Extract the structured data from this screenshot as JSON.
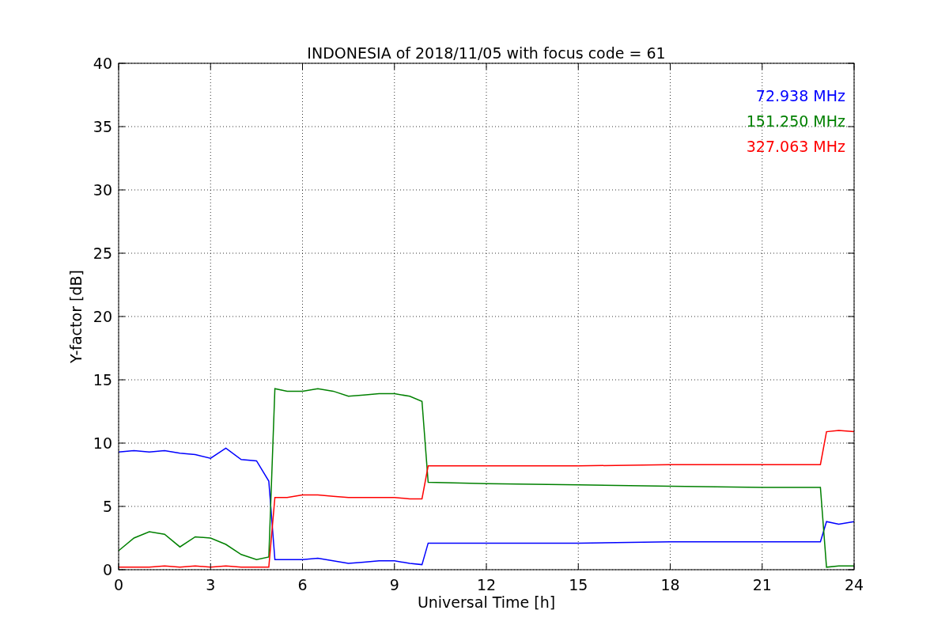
{
  "figure": {
    "chart_data": {
      "type": "line",
      "title": "INDONESIA of 2018/11/05 with focus code = 61",
      "xlabel": "Universal Time [h]",
      "ylabel": "Y-factor [dB]",
      "x": [
        0,
        0.5,
        1,
        1.5,
        2,
        2.5,
        3,
        3.5,
        4,
        4.5,
        4.9,
        5.1,
        5.5,
        6,
        6.5,
        7,
        7.5,
        8,
        8.5,
        9,
        9.5,
        9.9,
        10.1,
        12,
        15,
        18,
        21,
        22.9,
        23.1,
        23.5,
        24
      ],
      "series": [
        {
          "name": "72.938 MHz",
          "color": "#0000ff",
          "values": [
            9.3,
            9.4,
            9.3,
            9.4,
            9.2,
            9.1,
            8.8,
            9.6,
            8.7,
            8.6,
            7.0,
            0.8,
            0.8,
            0.8,
            0.9,
            0.7,
            0.5,
            0.6,
            0.7,
            0.7,
            0.5,
            0.4,
            2.1,
            2.1,
            2.1,
            2.2,
            2.2,
            2.2,
            3.8,
            3.6,
            3.8
          ]
        },
        {
          "name": "151.250 MHz",
          "color": "#008000",
          "values": [
            1.5,
            2.5,
            3.0,
            2.8,
            1.8,
            2.6,
            2.5,
            2.0,
            1.2,
            0.8,
            1.0,
            14.3,
            14.1,
            14.1,
            14.3,
            14.1,
            13.7,
            13.8,
            13.9,
            13.9,
            13.7,
            13.3,
            6.9,
            6.8,
            6.7,
            6.6,
            6.5,
            6.5,
            0.2,
            0.3,
            0.3
          ]
        },
        {
          "name": "327.063 MHz",
          "color": "#ff0000",
          "values": [
            0.2,
            0.2,
            0.2,
            0.3,
            0.2,
            0.3,
            0.2,
            0.3,
            0.2,
            0.2,
            0.2,
            5.7,
            5.7,
            5.9,
            5.9,
            5.8,
            5.7,
            5.7,
            5.7,
            5.7,
            5.6,
            5.6,
            8.2,
            8.2,
            8.2,
            8.3,
            8.3,
            8.3,
            10.9,
            11.0,
            10.9
          ]
        }
      ],
      "grid": true,
      "xlim": [
        0,
        24
      ],
      "ylim": [
        0,
        40
      ],
      "xticks": [
        0,
        3,
        6,
        9,
        12,
        15,
        18,
        21,
        24
      ],
      "yticks": [
        0,
        5,
        10,
        15,
        20,
        25,
        30,
        35,
        40
      ]
    }
  }
}
